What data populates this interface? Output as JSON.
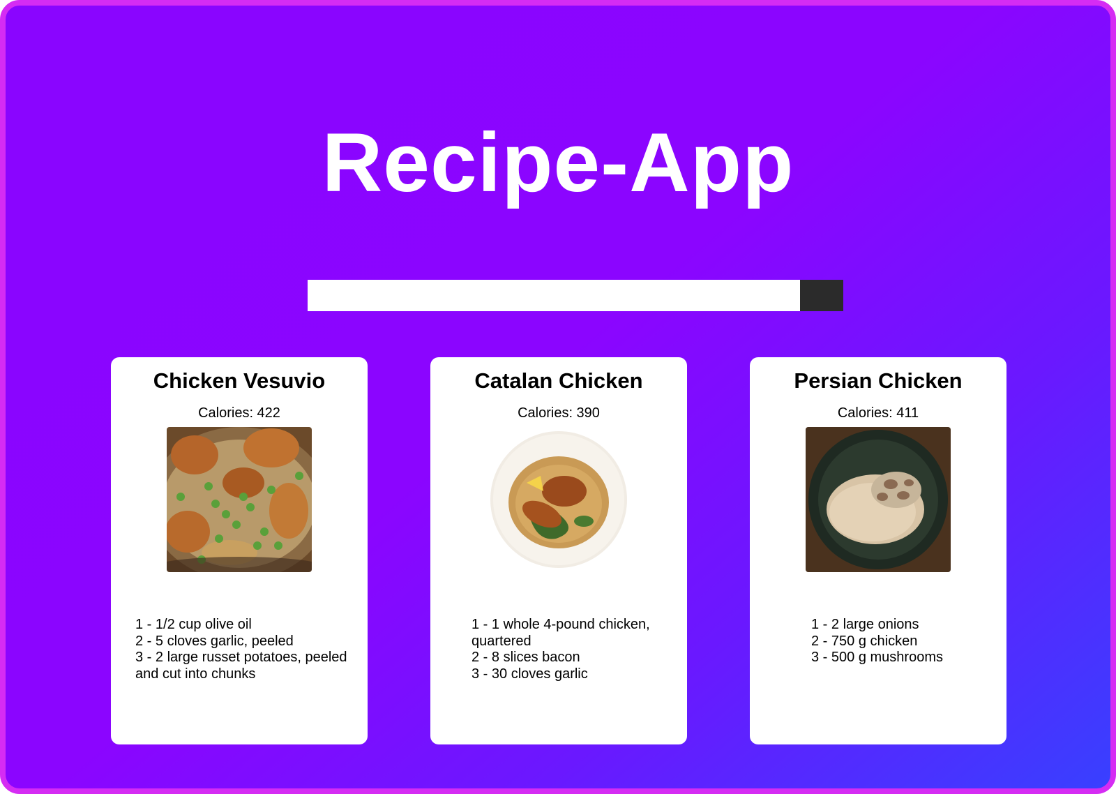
{
  "app": {
    "title": "Recipe-App"
  },
  "search": {
    "value": "",
    "placeholder": "",
    "button_label": ""
  },
  "colors": {
    "background_gradient_start": "#8a05ff",
    "background_gradient_end": "#3840ff",
    "frame_border": "#d52cf3",
    "search_button": "#2b2b2b",
    "card_background": "#ffffff"
  },
  "recipes": [
    {
      "title": "Chicken Vesuvio",
      "calories": "Calories: 422",
      "image": "chicken-vesuvio-photo",
      "ingredients": [
        "1 -  1/2 cup olive oil",
        "2 - 5 cloves garlic, peeled",
        "3 - 2 large russet potatoes, peeled and cut into chunks"
      ]
    },
    {
      "title": "Catalan Chicken",
      "calories": "Calories: 390",
      "image": "catalan-chicken-photo",
      "ingredients": [
        "1 - 1 whole 4-pound chicken, quartered",
        "2 - 8 slices bacon",
        "3 - 30 cloves garlic"
      ]
    },
    {
      "title": "Persian Chicken",
      "calories": "Calories: 411",
      "image": "persian-chicken-photo",
      "ingredients": [
        "1 -  2 large onions",
        "2 - 750 g chicken",
        "3 - 500 g mushrooms"
      ]
    }
  ]
}
